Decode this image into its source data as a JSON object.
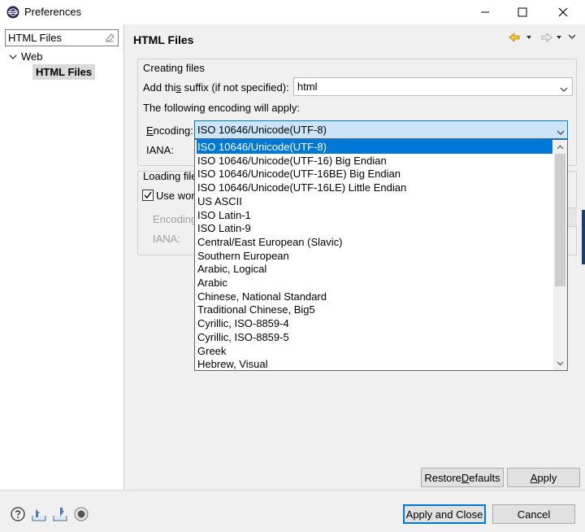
{
  "window": {
    "title": "Preferences",
    "controls": {
      "minimize": "–",
      "maximize": "☐",
      "close": "✕"
    }
  },
  "left_pane": {
    "filter_value": "HTML Files",
    "tree": [
      {
        "label": "Web",
        "expanded": true
      },
      {
        "label": "HTML Files",
        "selected": true
      }
    ]
  },
  "page": {
    "title": "HTML Files"
  },
  "creating_files": {
    "legend": "Creating files",
    "suffix_label": "Add this suffix (if not specified):",
    "suffix_value": "html",
    "following_label": "The following encoding will apply:",
    "encoding_label": "Encoding:",
    "encoding_value": "ISO 10646/Unicode(UTF-8)",
    "iana_label": "IANA:"
  },
  "loading_files": {
    "legend": "Loading file",
    "checkbox_label": "Use wor",
    "checkbox_checked": true,
    "encoding_label": "Encoding",
    "iana_label": "IANA:"
  },
  "encoding_options": [
    "ISO 10646/Unicode(UTF-8)",
    "ISO 10646/Unicode(UTF-16) Big Endian",
    "ISO 10646/Unicode(UTF-16BE) Big Endian",
    "ISO 10646/Unicode(UTF-16LE) Little Endian",
    "US ASCII",
    "ISO Latin-1",
    "ISO Latin-9",
    "Central/East European (Slavic)",
    "Southern European",
    "Arabic, Logical",
    "Arabic",
    "Chinese, National Standard",
    "Traditional Chinese, Big5",
    "Cyrillic, ISO-8859-4",
    "Cyrillic, ISO-8859-5",
    "Greek",
    "Hebrew, Visual"
  ],
  "selected_encoding_index": 0,
  "buttons": {
    "restore_defaults": "Restore Defaults",
    "apply": "Apply",
    "apply_and_close": "Apply and Close",
    "cancel": "Cancel"
  },
  "icons": {
    "app": "eclipse-icon",
    "back": "back-arrow-icon",
    "forward": "forward-arrow-icon",
    "help": "help-icon",
    "import": "import-icon",
    "export": "export-icon",
    "record": "record-icon"
  },
  "colors": {
    "selection": "#0078d7",
    "focus_field": "#cce4f7"
  }
}
